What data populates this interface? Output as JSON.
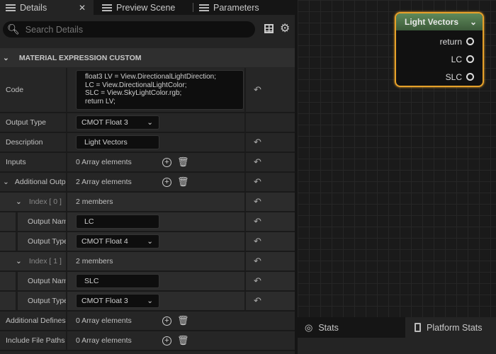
{
  "tabs": [
    {
      "label": "Details"
    },
    {
      "label": "Preview Scene"
    },
    {
      "label": "Parameters"
    }
  ],
  "search": {
    "placeholder": "Search Details"
  },
  "section": {
    "title": "MATERIAL EXPRESSION CUSTOM"
  },
  "code": {
    "label": "Code",
    "lines": [
      "float3 LV = View.DirectionalLightDirection;",
      "LC = View.DirectionalLightColor;",
      "SLC = View.SkyLightColor.rgb;",
      "return LV;"
    ]
  },
  "output_type": {
    "label": "Output Type",
    "value": "CMOT Float 3"
  },
  "description": {
    "label": "Description",
    "value": "Light Vectors"
  },
  "inputs": {
    "label": "Inputs",
    "value": "0 Array elements"
  },
  "additional_outputs": {
    "label": "Additional Outputs",
    "value": "2 Array elements"
  },
  "index0": {
    "label": "Index [ 0 ]",
    "value": "2 members",
    "name_label": "Output Name",
    "name_value": "LC",
    "type_label": "Output Type",
    "type_value": "CMOT Float 4"
  },
  "index1": {
    "label": "Index [ 1 ]",
    "value": "2 members",
    "name_label": "Output Name",
    "name_value": "SLC",
    "type_label": "Output Type",
    "type_value": "CMOT Float 3"
  },
  "additional_defines": {
    "label": "Additional Defines",
    "value": "0 Array elements"
  },
  "include_paths": {
    "label": "Include File Paths",
    "value": "0 Array elements"
  },
  "node": {
    "title": "Light Vectors",
    "pins": [
      "return",
      "LC",
      "SLC"
    ]
  },
  "bottom_tabs": [
    {
      "label": "Stats"
    },
    {
      "label": "Platform Stats"
    }
  ]
}
